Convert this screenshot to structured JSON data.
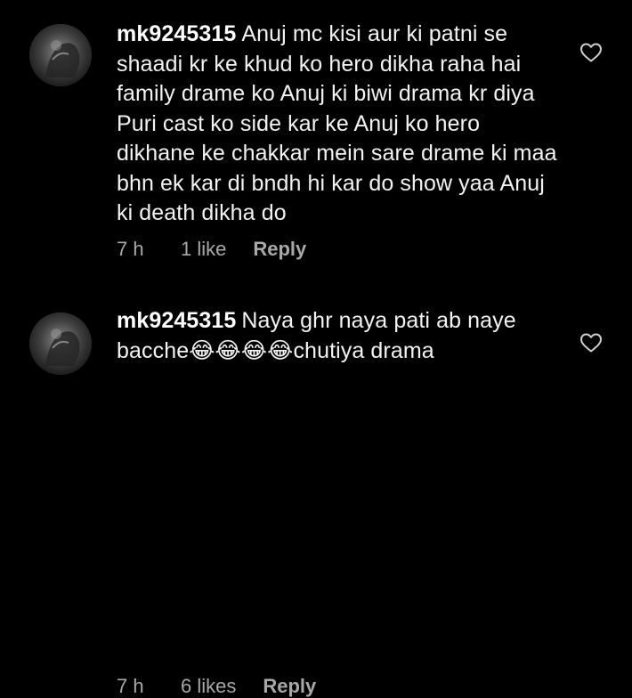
{
  "comments": [
    {
      "username": "mk9245315",
      "text": "Anuj mc kisi aur ki patni se shaadi kr ke khud ko hero dikha raha hai family drame ko Anuj ki biwi drama kr diya Puri cast ko side kar ke Anuj ko hero dikhane ke chakkar mein sare drame ki maa bhn ek kar di bndh hi kar do show yaa Anuj ki death dikha do",
      "time": "7 h",
      "likes": "1 like",
      "reply": "Reply",
      "like_icon": "heart-outline-icon",
      "avatar_icon": "avatar-photo"
    },
    {
      "username": "mk9245315",
      "text": "Naya ghr naya pati ab naye bacche😂😂😂😂chutiya drama",
      "time": "7 h",
      "likes": "6 likes",
      "reply": "Reply",
      "like_icon": "heart-outline-icon",
      "avatar_icon": "avatar-photo"
    }
  ],
  "colors": {
    "background": "#000000",
    "text": "#f2f2f2",
    "meta": "#a8a8a8"
  }
}
